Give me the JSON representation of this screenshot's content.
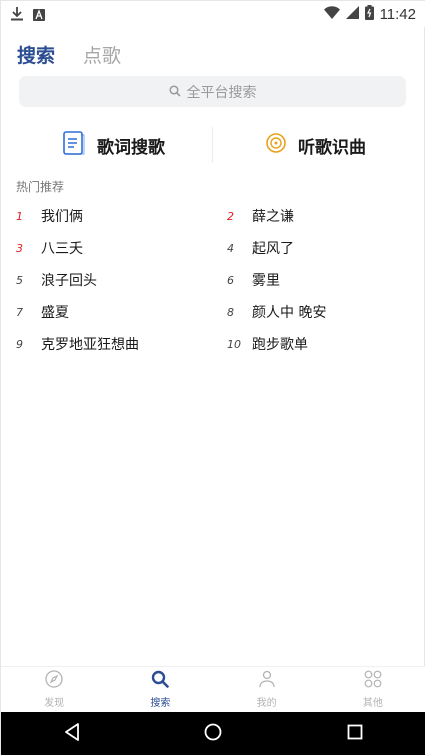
{
  "status_bar": {
    "time": "11:42",
    "icons": [
      "download-icon",
      "notification-a-icon",
      "wifi-icon",
      "signal-icon",
      "battery-icon"
    ]
  },
  "top_tabs": [
    {
      "label": "搜索",
      "active": true
    },
    {
      "label": "点歌",
      "active": false
    }
  ],
  "search": {
    "placeholder": "全平台搜索"
  },
  "features": {
    "lyrics_label": "歌词搜歌",
    "identify_label": "听歌识曲"
  },
  "hot": {
    "title": "热门推荐",
    "items": [
      {
        "rank": "1",
        "name": "我们俩",
        "top": true
      },
      {
        "rank": "2",
        "name": "薛之谦",
        "top": true
      },
      {
        "rank": "3",
        "name": "八三夭",
        "top": true
      },
      {
        "rank": "4",
        "name": "起风了",
        "top": false
      },
      {
        "rank": "5",
        "name": "浪子回头",
        "top": false
      },
      {
        "rank": "6",
        "name": "雾里",
        "top": false
      },
      {
        "rank": "7",
        "name": "盛夏",
        "top": false
      },
      {
        "rank": "8",
        "name": "颜人中 晚安",
        "top": false
      },
      {
        "rank": "9",
        "name": "克罗地亚狂想曲",
        "top": false
      },
      {
        "rank": "10",
        "name": "跑步歌单",
        "top": false
      }
    ]
  },
  "bottom_nav": [
    {
      "label": "发现",
      "icon": "compass-icon",
      "active": false
    },
    {
      "label": "搜索",
      "icon": "search-icon",
      "active": true
    },
    {
      "label": "我的",
      "icon": "user-icon",
      "active": false
    },
    {
      "label": "其他",
      "icon": "grid-icon",
      "active": false
    }
  ],
  "colors": {
    "accent": "#2b4d91",
    "rank_top": "#e02020",
    "inactive": "#b3b3b3",
    "search_bg": "#f1f2f4"
  }
}
